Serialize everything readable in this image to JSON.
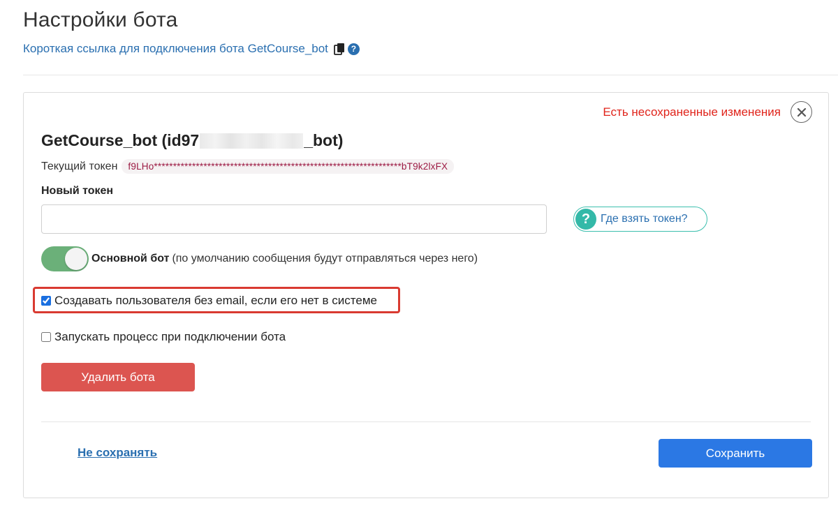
{
  "header": {
    "title": "Настройки бота",
    "short_link": "Короткая ссылка для подключения бота GetCourse_bot"
  },
  "card": {
    "unsaved_notice": "Есть несохраненные изменения",
    "bot_title_prefix": "GetCourse_bot (id97",
    "bot_title_suffix": "_bot)",
    "current_token_label": "Текущий токен",
    "current_token_value": "f9LHo*****************************************************************bT9k2lxFX",
    "new_token_label": "Новый токен",
    "new_token_value": "",
    "new_token_placeholder": "",
    "help_link": "Где взять токен?",
    "main_bot_label": "Основной бот",
    "main_bot_desc": "(по умолчанию сообщения будут отправляться через него)",
    "main_bot_enabled": true,
    "create_user_label": "Создавать пользователя без email, если его нет в системе",
    "create_user_checked": true,
    "run_process_label": "Запускать процесс при подключении бота",
    "run_process_checked": false,
    "delete_button": "Удалить бота",
    "discard_link": "Не сохранять",
    "save_button": "Сохранить"
  },
  "colors": {
    "link": "#2a6fb0",
    "danger": "#dc5550",
    "primary": "#2b78e4",
    "toggle_on": "#6bb079",
    "help_accent": "#34b9a8",
    "highlight": "#d93a31",
    "notice": "#e0241b"
  },
  "icons": {
    "copy": "copy-icon",
    "help": "question-icon",
    "close": "close-icon"
  }
}
